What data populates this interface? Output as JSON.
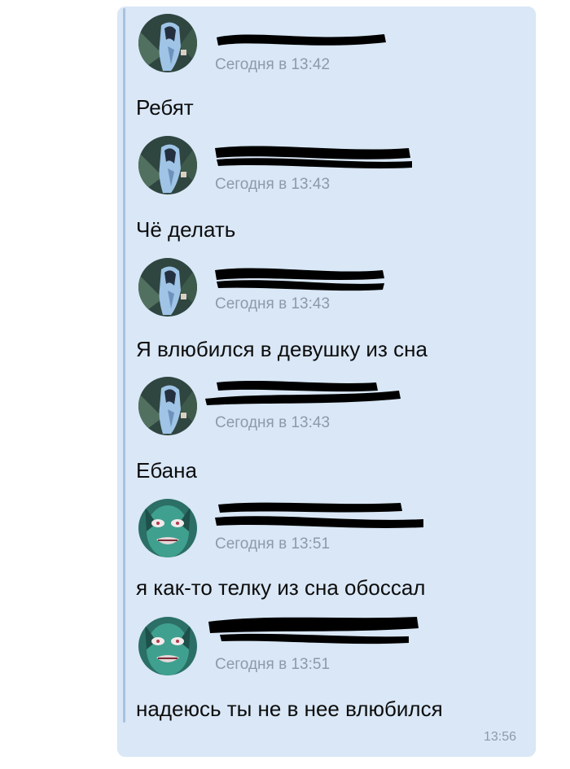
{
  "conversation": {
    "messages": [
      {
        "author_redacted": true,
        "avatar": "anime-character-avatar-blue",
        "timestamp": "Сегодня в 13:42",
        "text": "Ребят"
      },
      {
        "author_redacted": true,
        "avatar": "anime-character-avatar-blue",
        "timestamp": "Сегодня в 13:43",
        "text": "Чё делать"
      },
      {
        "author_redacted": true,
        "avatar": "anime-character-avatar-blue",
        "timestamp": "Сегодня в 13:43",
        "text": "Я влюбился в девушку из сна"
      },
      {
        "author_redacted": true,
        "avatar": "anime-character-avatar-blue",
        "timestamp": "Сегодня в 13:43",
        "text": "Ебана"
      },
      {
        "author_redacted": true,
        "avatar": "creepy-face-avatar-teal",
        "timestamp": "Сегодня в 13:51",
        "text": "я как-то телку из сна обоссал"
      },
      {
        "author_redacted": true,
        "avatar": "creepy-face-avatar-teal",
        "timestamp": "Сегодня в 13:51",
        "text": "надеюсь ты не в нее влюбился"
      }
    ],
    "send_time": "13:56"
  },
  "colors": {
    "bubble_background": "#d9e7f6",
    "quote_bar": "#a9c1dc",
    "timestamp": "#8d9aaa",
    "message_text": "#0d0d0d",
    "redaction": "#000000"
  }
}
